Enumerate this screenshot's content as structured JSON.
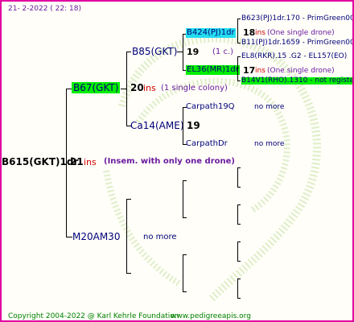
{
  "header": {
    "date": "21-  2-2022 (  22: 18)"
  },
  "root": {
    "name": "B615(GKT)1dr",
    "year": "21",
    "ins": "ins",
    "note": "(Insem. with only one drone)"
  },
  "gen1": {
    "top": {
      "name": "B67(GKT)",
      "year": "20",
      "ins": "ins",
      "note": "(1 single colony)",
      "color": "#00ee00"
    },
    "bottom": {
      "name": "M20AM30",
      "note": "no more"
    }
  },
  "gen2": {
    "a": {
      "name": "B85(GKT)"
    },
    "b": {
      "name": "Ca14(AME)",
      "year": "19"
    }
  },
  "gen3": {
    "a": {
      "name": "B424(PJ)1dr",
      "year": "19",
      "note": "(1 c.)",
      "color": "#22ddee"
    },
    "b": {
      "name": "EL36(MR)1dr",
      "year": "17",
      "color": "#00ee00"
    },
    "c": {
      "name": "Carpath19Q",
      "note": "no more"
    },
    "d": {
      "name": "CarpathDr",
      "note": "no more"
    }
  },
  "gen4": {
    "a": {
      "name": "B623(PJ)1dr.170 - PrimGreen00"
    },
    "a_year": "18",
    "a_ins": "ins",
    "a_note": "(One single drone)",
    "b": {
      "name": "B11(PJ)1dr.1659 - PrimGreen00"
    },
    "c": {
      "name": "EL8(RKR).15  .G2 - EL157(EO)"
    },
    "c_year": "17",
    "c_ins": "ins",
    "c_note": "(One single drone)",
    "d": {
      "name": "B14V1(RHO).1310 - not registe",
      "color": "#00ee00"
    }
  },
  "footer": {
    "copyright": "Copyright 2004-2022 @ Karl Kehrle Foundation",
    "url": "www.pedigreeapis.org"
  }
}
